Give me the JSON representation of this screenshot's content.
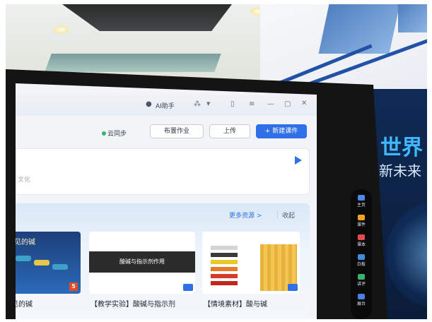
{
  "window": {
    "assistant_label": "AI助手",
    "titlebar_icons": [
      "assistant-avatar-icon",
      "tools-icon",
      "chevron-down-icon",
      "layout-icon",
      "menu-icon",
      "minimize-icon",
      "maximize-icon",
      "close-icon"
    ]
  },
  "toolbar": {
    "cloud_sync": "云同步",
    "assign_homework": "布置作业",
    "upload": "上传",
    "new_courseware": "+ 新建课件"
  },
  "input": {
    "hint_fragment": "文化",
    "send_icon": "send-icon"
  },
  "resources": {
    "more_label": "更多资源 >",
    "collapse_label": "收起",
    "cards": [
      {
        "chalk_text": "见的碱",
        "caption": "见的碱",
        "badge": "5"
      },
      {
        "banner_text": "酸碱与指示剂作用",
        "caption": "【教学实验】酸碱与指示剂"
      },
      {
        "caption": "【情境素材】酸与碱"
      }
    ]
  },
  "sidebar": {
    "items": [
      {
        "label": "主页",
        "color": "#4f87e8"
      },
      {
        "label": "课件",
        "color": "#f0a323"
      },
      {
        "label": "课本",
        "color": "#e24b4b"
      },
      {
        "label": "白板",
        "color": "#3f8de0"
      },
      {
        "label": "讲评",
        "color": "#39b36b"
      },
      {
        "label": "展台",
        "color": "#4a7fe0"
      }
    ]
  },
  "display": {
    "line1": "世界",
    "line2": "新未来"
  },
  "colors": {
    "accent": "#2f6fe8",
    "screen_bg": "#f2f4f7"
  }
}
